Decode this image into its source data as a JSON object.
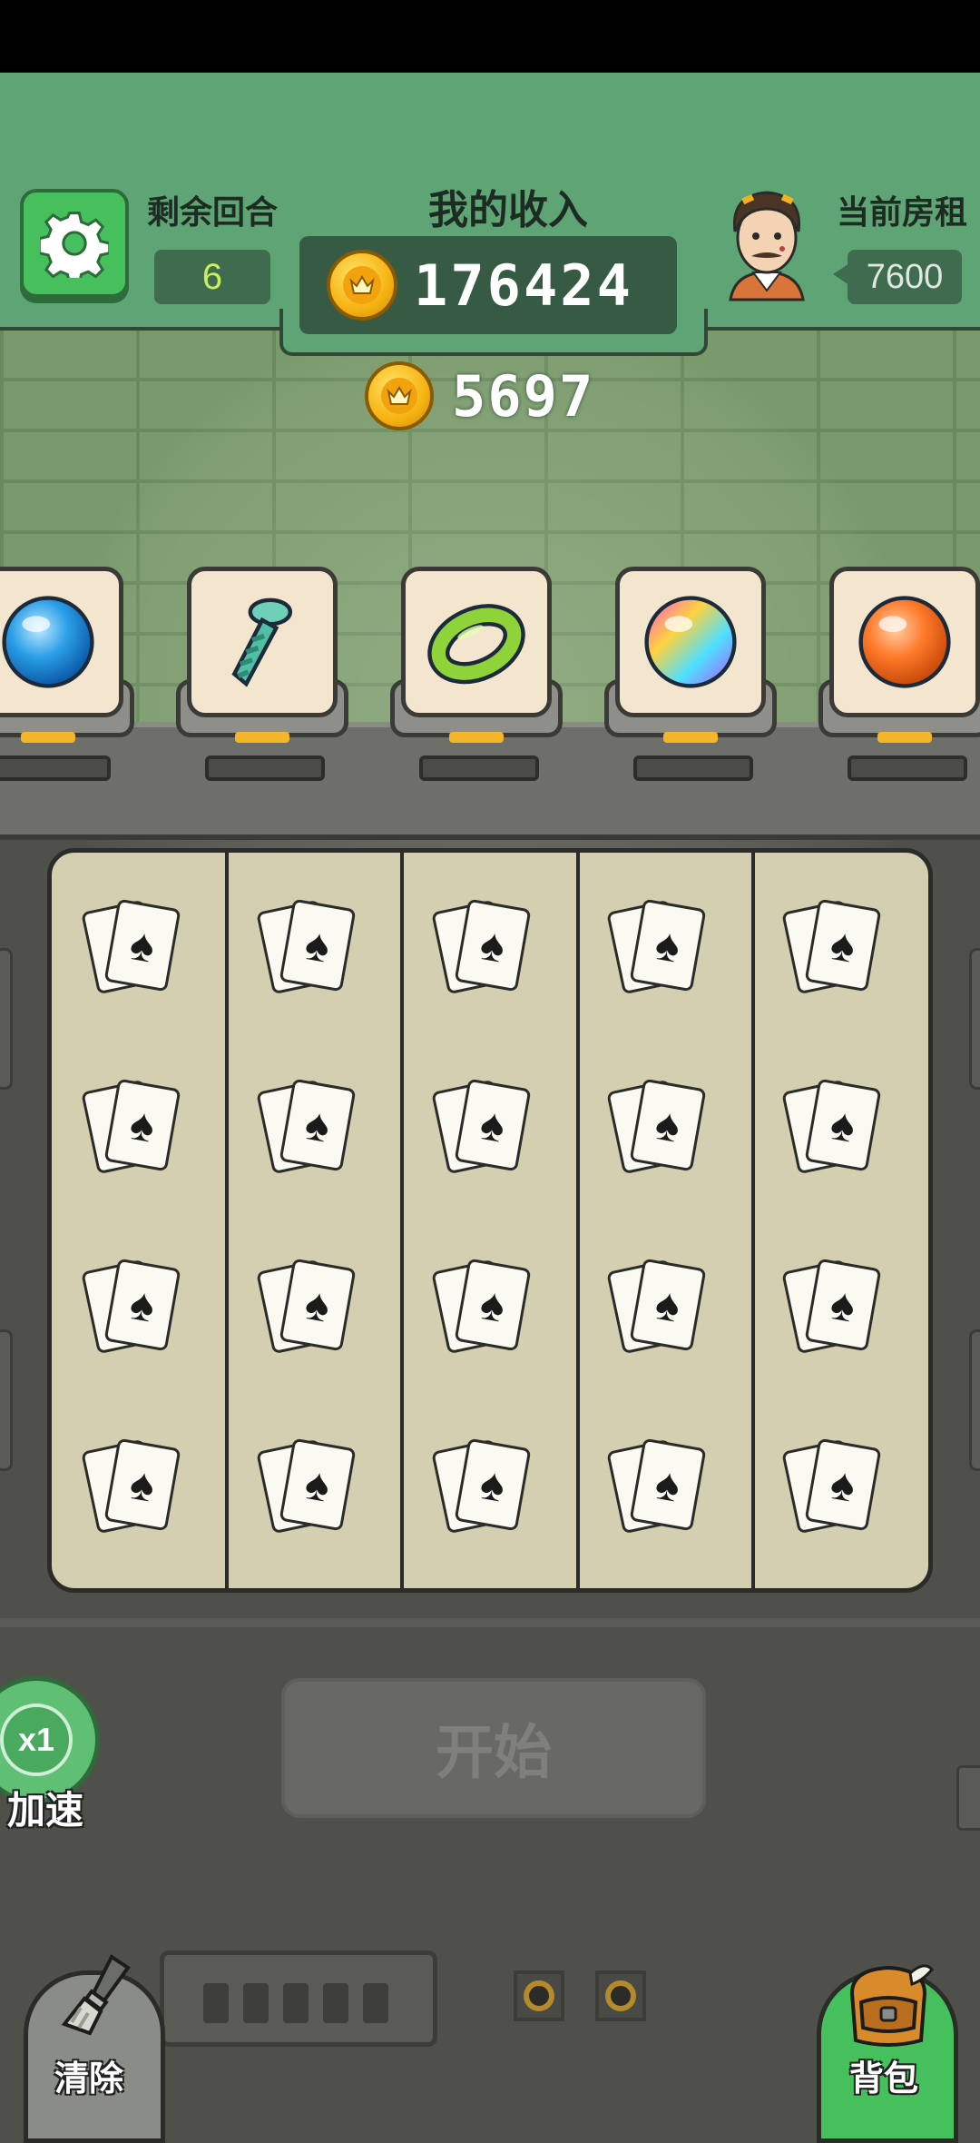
{
  "header": {
    "rounds_label": "剩余回合",
    "rounds_value": "6",
    "income_label": "我的收入",
    "income_value": "176424",
    "rent_label": "当前房租",
    "rent_value": "7600"
  },
  "round_income": "5697",
  "items": [
    {
      "name": "blue-orb-icon"
    },
    {
      "name": "striped-tie-icon"
    },
    {
      "name": "green-ring-icon"
    },
    {
      "name": "rainbow-orb-icon"
    },
    {
      "name": "orange-orb-icon"
    }
  ],
  "board": {
    "columns": 5,
    "rows": 4,
    "card_icon": "spade-card-icon"
  },
  "controls": {
    "speed_multiplier": "x1",
    "speed_label": "加速",
    "start_label": "开始",
    "clear_label": "清除",
    "bag_label": "背包"
  },
  "colors": {
    "header_green": "#5fa474",
    "accent_green": "#46c05c",
    "coin_gold": "#f6b312",
    "rounds_text": "#c9ef60"
  }
}
